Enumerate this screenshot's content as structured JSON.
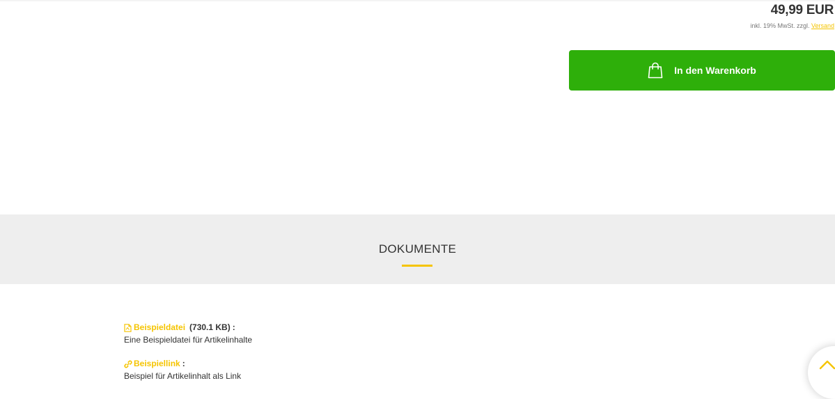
{
  "product": {
    "price": "49,99 EUR",
    "tax_note": "inkl. 19% MwSt. zzgl.",
    "shipping_link": "Versand"
  },
  "cart": {
    "button_label": "In den Warenkorb",
    "button_color": "#2eaf0a",
    "icon": "shopping-bag-icon"
  },
  "documents": {
    "section_title": "DOKUMENTE",
    "accent_color": "#f5c400",
    "items": [
      {
        "icon": "pdf-file-icon",
        "name": "Beispieldatei",
        "size": "(730.1 KB)",
        "colon": ":",
        "description": "Eine Beispieldatei für Artikelinhalte"
      },
      {
        "icon": "link-icon",
        "name": "Beispiellink",
        "colon": ":",
        "description": "Beispiel für Artikelinhalt als Link"
      }
    ]
  },
  "scroll_top": {
    "icon": "chevron-up-icon"
  }
}
